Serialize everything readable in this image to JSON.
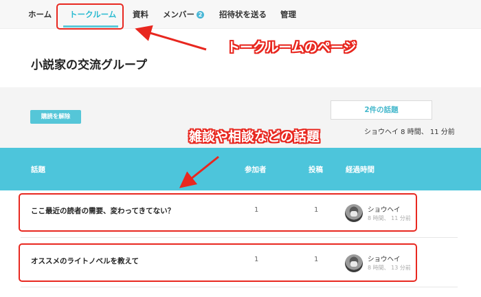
{
  "nav": {
    "items": [
      {
        "label": "ホーム"
      },
      {
        "label": "トークルーム"
      },
      {
        "label": "資料"
      },
      {
        "label": "メンバー",
        "badge": "2"
      },
      {
        "label": "招待状を送る"
      },
      {
        "label": "管理"
      }
    ]
  },
  "group": {
    "title": "小説家の交流グループ"
  },
  "actions": {
    "unsubscribe_label": "購読を解除",
    "topic_count": "2件の話題",
    "latest_activity": "ショウヘイ 8 時間、 11 分前"
  },
  "table": {
    "headers": {
      "topic": "話題",
      "participants": "参加者",
      "posts": "投稿",
      "elapsed": "経過時間"
    },
    "rows": [
      {
        "title": "ここ最近の読者の需要、変わってきてない？",
        "participants": "1",
        "posts": "1",
        "user": "ショウヘイ",
        "elapsed": "8 時間、 11 分前"
      },
      {
        "title": "オススメのライトノベルを教えて",
        "participants": "1",
        "posts": "1",
        "user": "ショウヘイ",
        "elapsed": "8 時間、 13 分前"
      }
    ]
  },
  "annotations": {
    "talkroom_label": "トークルームのページ",
    "topics_label": "雑談や相談などの話題"
  },
  "colors": {
    "accent": "#4dc5db",
    "annotation": "#e8271f"
  }
}
